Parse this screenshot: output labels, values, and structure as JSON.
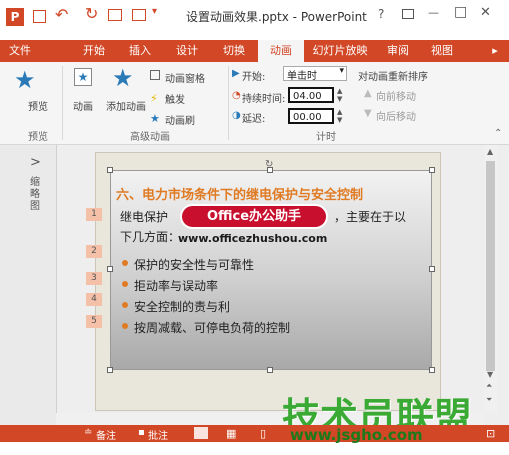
{
  "app": {
    "window_title": "设置动画效果.pptx - PowerPoint",
    "question_mark": "?",
    "minimize": "—",
    "restore": "□",
    "close": "✕"
  },
  "tabs": [
    {
      "label": "文件"
    },
    {
      "label": "开始"
    },
    {
      "label": "插入"
    },
    {
      "label": "设计"
    },
    {
      "label": "切换"
    },
    {
      "label": "动画"
    },
    {
      "label": "幻灯片放映"
    },
    {
      "label": "审阅"
    },
    {
      "label": "视图"
    }
  ],
  "ribbon": {
    "preview": "预览",
    "preview_group": "预览",
    "animation": "动画",
    "add_animation": "添加动画",
    "animation_pane": "动画窗格",
    "trigger": "触发",
    "animation_painter": "动画刷",
    "advanced_group": "高级动画",
    "start_label": "开始:",
    "start_value": "单击时",
    "duration_label": "持续时间:",
    "duration_value": "04.00",
    "delay_label": "延迟:",
    "delay_value": "00.00",
    "timing_group": "计时",
    "reorder_title": "对动画重新排序",
    "move_earlier": "向前移动",
    "move_later": "向后移动"
  },
  "left_pane": {
    "collapse": ">",
    "thumbnails": "缩略图"
  },
  "slide": {
    "title": "六、电力市场条件下的继电保护与安全控制",
    "intro_line1": "继电保护",
    "intro_line1_tail": "，主要在于以",
    "intro_line2": "下几方面：",
    "bullets": [
      "保护的安全性与可靠性",
      "拒动率与误动率",
      "安全控制的责与利",
      "按周减载、可停电负荷的控制"
    ],
    "anim_numbers": [
      "1",
      "2",
      "3",
      "4",
      "5"
    ]
  },
  "watermark": {
    "badge": "Office办公助手",
    "url": "www.officezhushou.com",
    "brand": "技术员联盟",
    "brand_url": "www.jsgho.com"
  },
  "status": {
    "notes": "备注",
    "comments": "批注"
  },
  "colors": {
    "accent": "#d24726",
    "title_orange": "#e07b23",
    "badge_red": "#c8102e",
    "brand_green": "#3aaa35"
  }
}
